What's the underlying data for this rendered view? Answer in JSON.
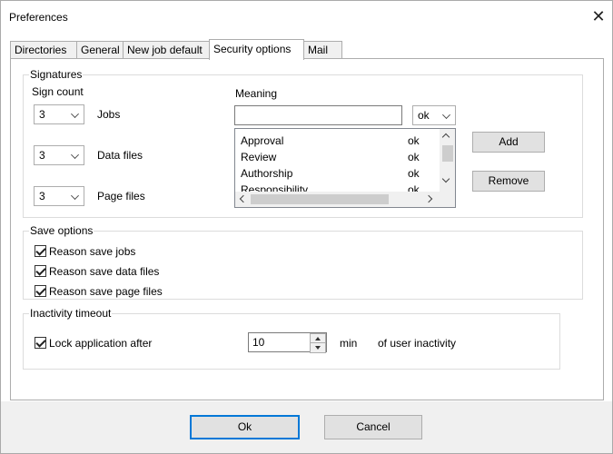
{
  "window": {
    "title": "Preferences",
    "close_glyph": "✕"
  },
  "tabs": [
    {
      "label": "Directories",
      "active": false
    },
    {
      "label": "General",
      "active": false
    },
    {
      "label": "New job default",
      "active": false
    },
    {
      "label": "Security options",
      "active": true
    },
    {
      "label": "Mail",
      "active": false
    }
  ],
  "signatures": {
    "group_label": "Signatures",
    "sign_count_label": "Sign count",
    "meaning_label": "Meaning",
    "rows": [
      {
        "count": "3",
        "label": "Jobs"
      },
      {
        "count": "3",
        "label": "Data files"
      },
      {
        "count": "3",
        "label": "Page files"
      }
    ],
    "meaning_input_value": "",
    "meaning_combo_value": "ok",
    "list": [
      {
        "name": "Approval",
        "value": "ok"
      },
      {
        "name": "Review",
        "value": "ok"
      },
      {
        "name": "Authorship",
        "value": "ok"
      },
      {
        "name": "Responsibility",
        "value": "ok"
      }
    ],
    "add_label": "Add",
    "remove_label": "Remove"
  },
  "save_options": {
    "group_label": "Save options",
    "items": [
      {
        "label": "Reason save jobs",
        "checked": true
      },
      {
        "label": "Reason save data files",
        "checked": true
      },
      {
        "label": "Reason save page files",
        "checked": true
      }
    ]
  },
  "inactivity": {
    "group_label": "Inactivity timeout",
    "lock_label": "Lock application after",
    "lock_checked": true,
    "minutes_value": "10",
    "unit_label": "min",
    "suffix_label": "of user inactivity"
  },
  "footer": {
    "ok_label": "Ok",
    "cancel_label": "Cancel"
  },
  "colors": {
    "accent": "#0078d7",
    "button_face": "#e1e1e1",
    "border": "#adadad"
  }
}
